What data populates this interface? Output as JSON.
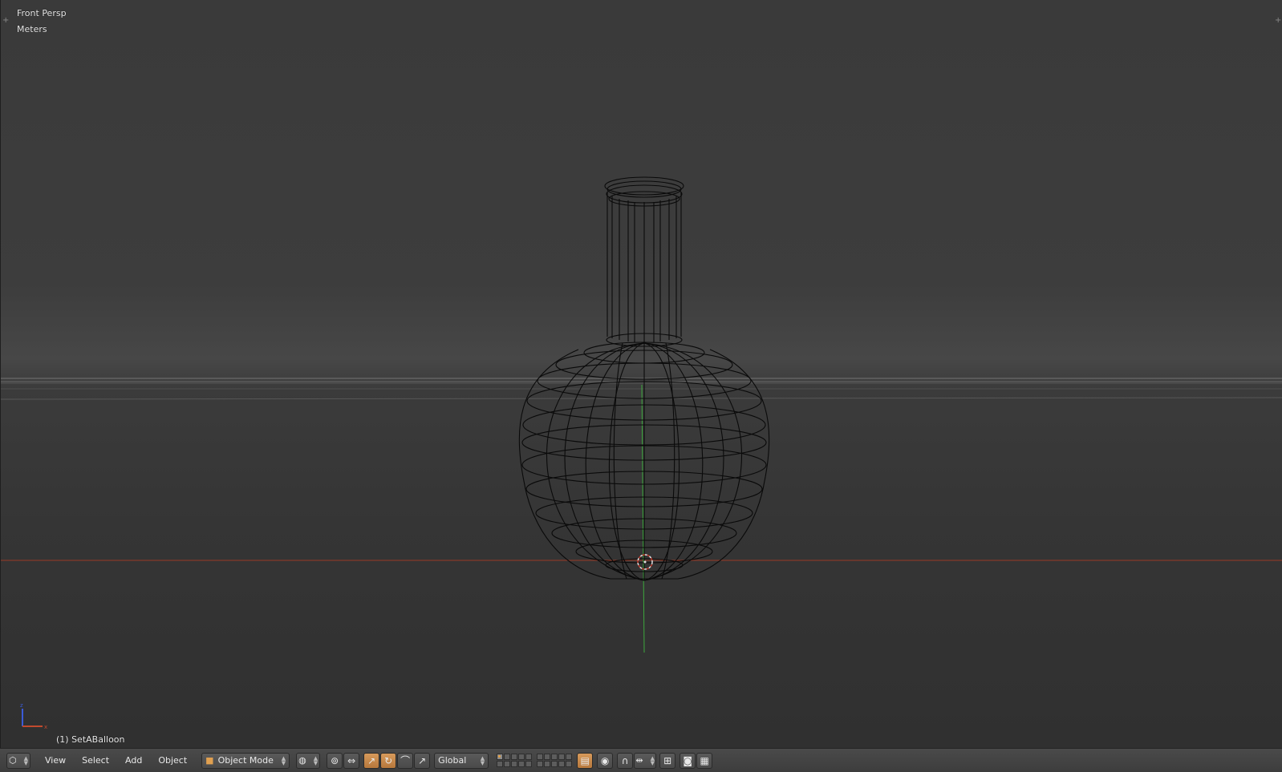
{
  "viewport": {
    "view_name": "Front Persp",
    "units": "Meters",
    "active_object": "(1) SetABalloon"
  },
  "header": {
    "menus": [
      "View",
      "Select",
      "Add",
      "Object"
    ],
    "mode": "Object Mode",
    "transform_orientation": "Global",
    "icons": {
      "editor_type": "3d-view-cube-icon",
      "viewport_shading": "sphere-wire-icon",
      "pivot": "pivot-point-icon",
      "manipulator": "manipulator-icon",
      "translate": "translate-arrow-icon",
      "rotate": "rotate-arc-icon",
      "scale": "scale-arrow-icon",
      "lock_layers": "lock-layers-icon",
      "proportional": "proportional-edit-icon",
      "snap": "magnet-icon",
      "snap_element": "snap-increment-icon",
      "snap_target": "snap-target-icon",
      "render_still": "camera-render-icon",
      "render_anim": "clapper-render-icon"
    }
  },
  "colors": {
    "x_axis": "#c24a2e",
    "y_axis": "#3da83d",
    "z_axis": "#3b5bd8",
    "wire": "#0a0a0a",
    "accent": "#d08a40"
  }
}
